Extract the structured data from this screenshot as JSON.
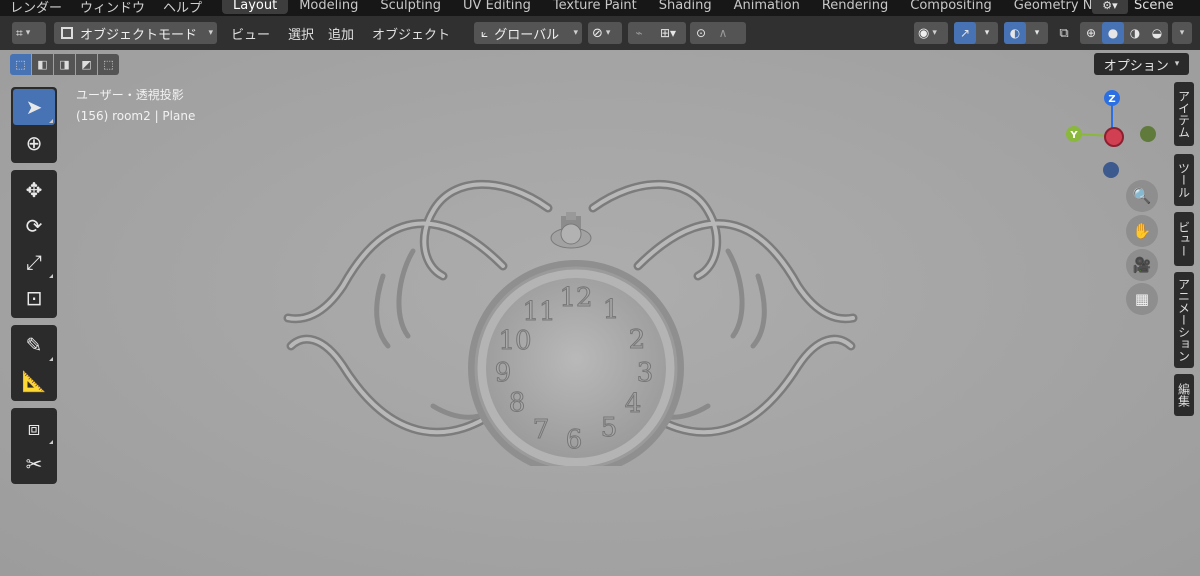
{
  "topbar": {
    "menus": [
      "レンダー",
      "ウィンドウ",
      "ヘルプ"
    ],
    "workspaces": [
      "Layout",
      "Modeling",
      "Sculpting",
      "UV Editing",
      "Texture Paint",
      "Shading",
      "Animation",
      "Rendering",
      "Compositing",
      "Geometry Nodes"
    ],
    "active_workspace": "Layout",
    "scene_label": "Scene"
  },
  "header": {
    "mode_label": "オブジェクトモード",
    "menus": [
      "ビュー",
      "選択",
      "追加",
      "オブジェクト"
    ],
    "transform_orientation": "グローバル"
  },
  "viewport": {
    "options_label": "オプション",
    "view_name": "ユーザー・透視投影",
    "object_info": "(156) room2 | Plane",
    "gizmo": {
      "z": "Z",
      "y": "Y"
    },
    "sidebar_tabs": [
      "アイテム",
      "ツール",
      "ビュー",
      "アニメーション",
      "編集"
    ],
    "clock_numbers": [
      "12",
      "1",
      "2",
      "3",
      "4",
      "5",
      "6",
      "7",
      "8",
      "9",
      "10",
      "11"
    ]
  },
  "colors": {
    "accent": "#4772b3",
    "viewport_bg": "#a5a5a5",
    "axis_z": "#2b6fe2",
    "axis_y": "#8ab83c",
    "axis_x": "#d13f52"
  }
}
